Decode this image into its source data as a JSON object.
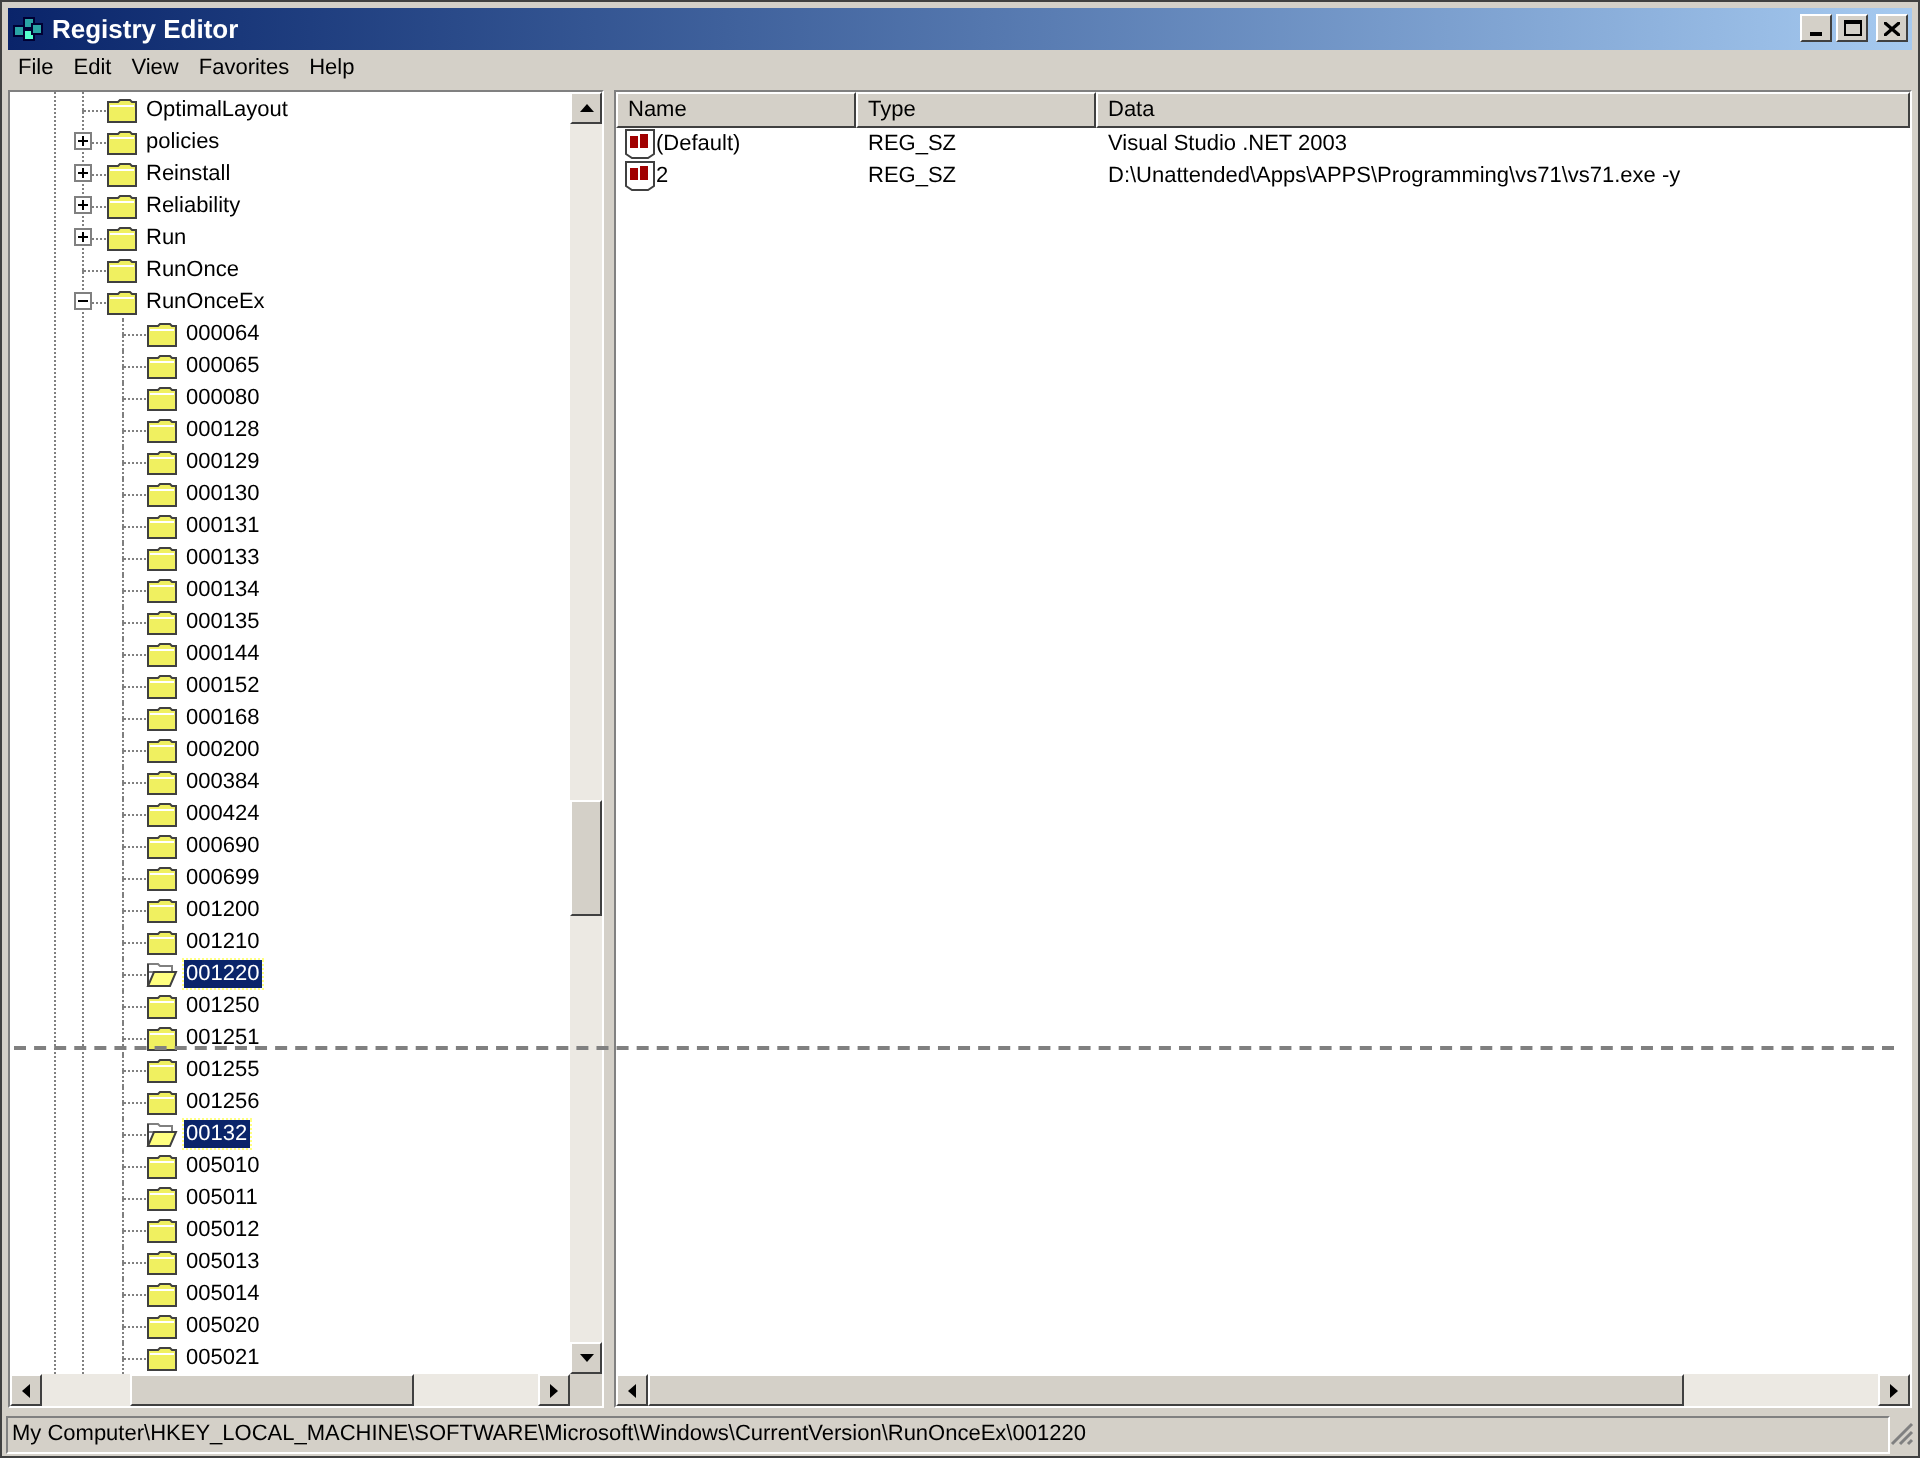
{
  "window": {
    "title": "Registry Editor"
  },
  "menu": [
    "File",
    "Edit",
    "View",
    "Favorites",
    "Help"
  ],
  "tree": [
    {
      "label": "OptimalLayout",
      "selected": false
    },
    {
      "label": "policies",
      "selected": false,
      "expanded": false
    },
    {
      "label": "Reinstall",
      "selected": false,
      "expanded": false
    },
    {
      "label": "Reliability",
      "selected": false,
      "expanded": false
    },
    {
      "label": "Run",
      "selected": false,
      "expanded": false
    },
    {
      "label": "RunOnce",
      "selected": false
    },
    {
      "label": "RunOnceEx",
      "selected": false,
      "expanded": true,
      "children": [
        {
          "label": "000064",
          "selected": false
        },
        {
          "label": "000065",
          "selected": false
        },
        {
          "label": "000080",
          "selected": false
        },
        {
          "label": "000128",
          "selected": false
        },
        {
          "label": "000129",
          "selected": false
        },
        {
          "label": "000130",
          "selected": false
        },
        {
          "label": "000131",
          "selected": false
        },
        {
          "label": "000133",
          "selected": false
        },
        {
          "label": "000134",
          "selected": false
        },
        {
          "label": "000135",
          "selected": false
        },
        {
          "label": "000144",
          "selected": false
        },
        {
          "label": "000152",
          "selected": false
        },
        {
          "label": "000168",
          "selected": false
        },
        {
          "label": "000200",
          "selected": false
        },
        {
          "label": "000384",
          "selected": false
        },
        {
          "label": "000424",
          "selected": false
        },
        {
          "label": "000690",
          "selected": false
        },
        {
          "label": "000699",
          "selected": false
        },
        {
          "label": "001200",
          "selected": false
        },
        {
          "label": "001210",
          "selected": false
        },
        {
          "label": "001220",
          "selected": true
        },
        {
          "label": "001250",
          "selected": false
        },
        {
          "label": "001251",
          "selected": false
        },
        {
          "label": "001255",
          "selected": false
        },
        {
          "label": "001256",
          "selected": false
        },
        {
          "label": "00132",
          "selected": true
        },
        {
          "label": "005010",
          "selected": false
        },
        {
          "label": "005011",
          "selected": false
        },
        {
          "label": "005012",
          "selected": false
        },
        {
          "label": "005013",
          "selected": false
        },
        {
          "label": "005014",
          "selected": false
        },
        {
          "label": "005020",
          "selected": false
        },
        {
          "label": "005021",
          "selected": false
        }
      ]
    }
  ],
  "values": {
    "columns": [
      "Name",
      "Type",
      "Data"
    ],
    "rows": [
      {
        "name": "(Default)",
        "type": "REG_SZ",
        "data": "Visual Studio .NET 2003"
      },
      {
        "name": "2",
        "type": "REG_SZ",
        "data": "D:\\Unattended\\Apps\\APPS\\Programming\\vs71\\vs71.exe -y"
      }
    ]
  },
  "status_bar": "My Computer\\HKEY_LOCAL_MACHINE\\SOFTWARE\\Microsoft\\Windows\\CurrentVersion\\RunOnceEx\\001220"
}
